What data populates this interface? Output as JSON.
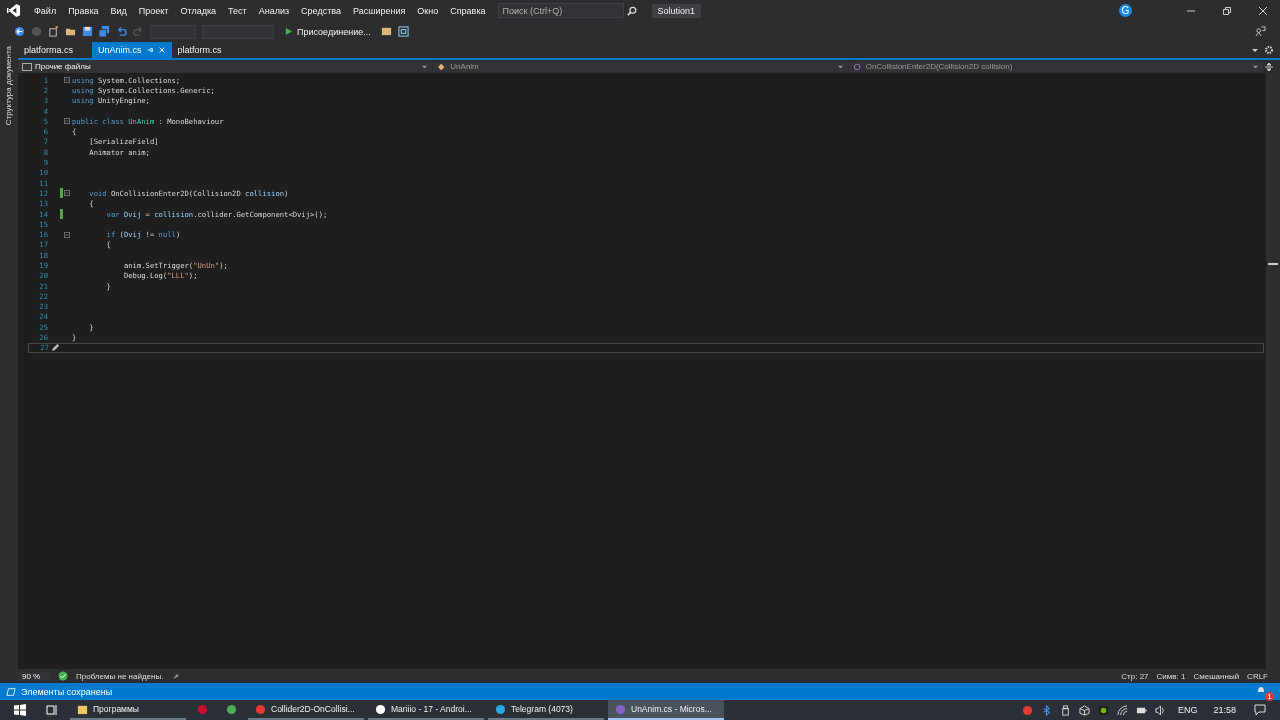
{
  "menu": [
    "Файл",
    "Правка",
    "Вид",
    "Проект",
    "Отладка",
    "Тест",
    "Анализ",
    "Средства",
    "Расширения",
    "Окно",
    "Справка"
  ],
  "search": {
    "placeholder": "Поиск (Ctrl+Q)"
  },
  "solution": "Solution1",
  "account": "G",
  "toolbar": {
    "run_label": "Присоединение..."
  },
  "side_tab": "Структура документа",
  "tabs": [
    {
      "label": "platforma.cs",
      "selected": false,
      "pinned": false
    },
    {
      "label": "UnAnim.cs",
      "selected": true,
      "pinned": true
    },
    {
      "label": "platform.cs",
      "selected": false,
      "pinned": false
    }
  ],
  "nav": {
    "project": "Прочие файлы",
    "class": "UnAnim",
    "member": "OnCollisionEnter2D(Collision2D collision)"
  },
  "code": [
    {
      "n": "1",
      "fold": true,
      "changed": false,
      "tokens": [
        {
          "t": "using",
          "kind": "kw"
        },
        {
          "t": " System.Collections;",
          "kind": "p"
        }
      ]
    },
    {
      "n": "2",
      "fold": false,
      "changed": false,
      "tokens": [
        {
          "t": "using",
          "kind": "kw"
        },
        {
          "t": " System.Collections.Generic;",
          "kind": "p"
        }
      ]
    },
    {
      "n": "3",
      "fold": false,
      "changed": false,
      "tokens": [
        {
          "t": "using",
          "kind": "kw"
        },
        {
          "t": " UnityEngine;",
          "kind": "p"
        }
      ]
    },
    {
      "n": "4",
      "fold": false,
      "changed": false
    },
    {
      "n": "5",
      "fold": true,
      "changed": false,
      "tokens": [
        {
          "t": "public class ",
          "kind": "kw"
        },
        {
          "t": "UnAnim",
          "kind": "type"
        },
        {
          "t": " : MonoBehaviour",
          "kind": "p"
        }
      ]
    },
    {
      "n": "6",
      "fold": false,
      "changed": false,
      "tokens": [
        {
          "t": "{",
          "kind": "p"
        }
      ]
    },
    {
      "n": "7",
      "fold": false,
      "changed": false,
      "tokens": [
        {
          "t": "    [SerializeField]",
          "kind": "p"
        }
      ]
    },
    {
      "n": "8",
      "fold": false,
      "changed": false,
      "tokens": [
        {
          "t": "    Animator anim;",
          "kind": "p"
        }
      ]
    },
    {
      "n": "9",
      "fold": false,
      "changed": false
    },
    {
      "n": "10",
      "fold": false,
      "changed": false
    },
    {
      "n": "11",
      "fold": false,
      "changed": false
    },
    {
      "n": "12",
      "fold": true,
      "changed": true,
      "tokens": [
        {
          "t": "    void",
          "kind": "kw"
        },
        {
          "t": " OnCollisionEnter2D(Collision2D ",
          "kind": "p"
        },
        {
          "t": "collision",
          "kind": "var"
        },
        {
          "t": ")",
          "kind": "p"
        }
      ]
    },
    {
      "n": "13",
      "fold": false,
      "changed": false,
      "tokens": [
        {
          "t": "    {",
          "kind": "p"
        }
      ]
    },
    {
      "n": "14",
      "fold": false,
      "changed": true,
      "tokens": [
        {
          "t": "        var ",
          "kind": "kw"
        },
        {
          "t": "Dvij",
          "kind": "var"
        },
        {
          "t": " = ",
          "kind": "p"
        },
        {
          "t": "collision",
          "kind": "var"
        },
        {
          "t": ".collider.GetComponent<Dvij>();",
          "kind": "p"
        }
      ]
    },
    {
      "n": "15",
      "fold": false,
      "changed": false
    },
    {
      "n": "16",
      "fold": true,
      "changed": false,
      "tokens": [
        {
          "t": "        if",
          "kind": "kw"
        },
        {
          "t": " (",
          "kind": "p"
        },
        {
          "t": "Dvij",
          "kind": "var"
        },
        {
          "t": " != ",
          "kind": "p"
        },
        {
          "t": "null",
          "kind": "kw"
        },
        {
          "t": ")",
          "kind": "p"
        }
      ]
    },
    {
      "n": "17",
      "fold": false,
      "changed": false,
      "tokens": [
        {
          "t": "        {",
          "kind": "p"
        }
      ]
    },
    {
      "n": "18",
      "fold": false,
      "changed": false
    },
    {
      "n": "19",
      "fold": false,
      "changed": false,
      "tokens": [
        {
          "t": "            anim.SetTrigger(",
          "kind": "p"
        },
        {
          "t": "\"UnUn\"",
          "kind": "str"
        },
        {
          "t": ");",
          "kind": "p"
        }
      ]
    },
    {
      "n": "20",
      "fold": false,
      "changed": false,
      "tokens": [
        {
          "t": "            Debug.Log(",
          "kind": "p"
        },
        {
          "t": "\"LLL\"",
          "kind": "str"
        },
        {
          "t": ");",
          "kind": "p"
        }
      ]
    },
    {
      "n": "21",
      "fold": false,
      "changed": false,
      "tokens": [
        {
          "t": "        }",
          "kind": "p"
        }
      ]
    },
    {
      "n": "22",
      "fold": false,
      "changed": false
    },
    {
      "n": "23",
      "fold": false,
      "changed": false
    },
    {
      "n": "24",
      "fold": false,
      "changed": false
    },
    {
      "n": "25",
      "fold": false,
      "changed": false,
      "tokens": [
        {
          "t": "    }",
          "kind": "p"
        }
      ]
    },
    {
      "n": "26",
      "fold": false,
      "changed": false,
      "tokens": [
        {
          "t": "}",
          "kind": "p"
        }
      ]
    },
    {
      "n": "27",
      "fold": false,
      "changed": false,
      "current": true
    }
  ],
  "editor_status": {
    "zoom": "90 %",
    "problems": "Проблемы не найдены.",
    "line": "Стр: 27",
    "col": "Симв: 1",
    "whitespace": "Смешанный",
    "eol": "CRLF"
  },
  "status_bar": {
    "message": "Элементы сохранены",
    "notifications": "1"
  },
  "taskbar": {
    "items": [
      {
        "label": "Программы",
        "kind": "folder",
        "selected": false
      },
      {
        "kind": "opera",
        "selected": false
      },
      {
        "kind": "chrome",
        "selected": false
      },
      {
        "label": "Collider2D-OnCollisi...",
        "kind": "yandex",
        "selected": false
      },
      {
        "label": "Mariiio - 17 - Androi...",
        "kind": "unity",
        "selected": false
      },
      {
        "label": "Telegram (4073)",
        "kind": "telegram",
        "selected": false
      },
      {
        "label": "UnAnim.cs - Micros...",
        "kind": "vs",
        "selected": true
      }
    ],
    "lang": "ENG",
    "time": "21:58"
  }
}
